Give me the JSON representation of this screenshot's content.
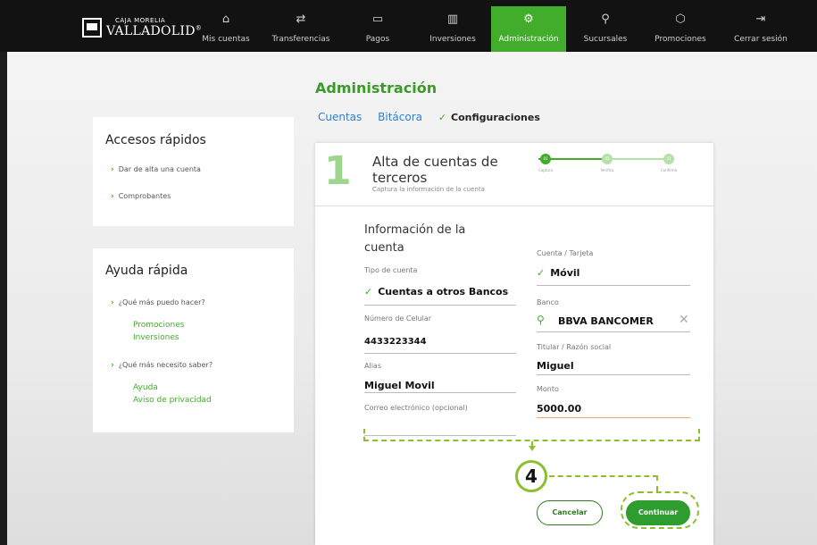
{
  "brand": {
    "line1": "CAJA MORELIA",
    "line2": "VALLADOLID",
    "mark": "®"
  },
  "nav": [
    {
      "label": "Mis cuentas",
      "icon": "home-icon",
      "glyph": "⌂"
    },
    {
      "label": "Transferencias",
      "icon": "transfer-icon",
      "glyph": "⇄"
    },
    {
      "label": "Pagos",
      "icon": "payments-icon",
      "glyph": "▭"
    },
    {
      "label": "Inversiones",
      "icon": "investments-icon",
      "glyph": "▥"
    },
    {
      "label": "Administración",
      "icon": "gear-icon",
      "glyph": "⚙"
    },
    {
      "label": "Sucursales",
      "icon": "location-icon",
      "glyph": "⚲"
    },
    {
      "label": "Promociones",
      "icon": "tag-icon",
      "glyph": "⬡"
    },
    {
      "label": "Cerrar sesión",
      "icon": "logout-icon",
      "glyph": "⇥"
    }
  ],
  "page": {
    "title": "Administración"
  },
  "breadcrumb": {
    "link1": "Cuentas",
    "link2": "Bitácora",
    "active": "Configuraciones"
  },
  "quick_access": {
    "title": "Accesos rápidos",
    "items": [
      "Dar de alta una cuenta",
      "Comprobantes"
    ]
  },
  "quick_help": {
    "title": "Ayuda rápida",
    "q1": "¿Qué más puedo hacer?",
    "q1_links": [
      "Promociones",
      "Inversiones"
    ],
    "q2": "¿Qué más necesito saber?",
    "q2_links": [
      "Ayuda",
      "Aviso de privacidad"
    ]
  },
  "form": {
    "step": "1",
    "title": "Alta de cuentas de terceros",
    "subtitle": "Captura la información de la cuenta",
    "stepper": [
      {
        "num": "01",
        "label": "Captura"
      },
      {
        "num": "02",
        "label": "Verifica"
      },
      {
        "num": "03",
        "label": "Confirma"
      }
    ],
    "section_title": "Información de la cuenta",
    "fields": {
      "tipo_label": "Tipo de cuenta",
      "tipo_value": "Cuentas a otros Bancos",
      "celular_label": "Número de Celular",
      "celular_value": "4433223344",
      "alias_label": "Alias",
      "alias_value": "Miguel Movil",
      "correo_label": "Correo electrónico (opcional)",
      "correo_value": "",
      "cuenta_label": "Cuenta / Tarjeta",
      "cuenta_value": "Móvil",
      "banco_label": "Banco",
      "banco_value": "BBVA BANCOMER",
      "titular_label": "Titular / Razón social",
      "titular_value": "Miguel",
      "monto_label": "Monto",
      "monto_value": "5000.00"
    },
    "cancel_label": "Cancelar",
    "continue_label": "Continuar"
  },
  "annotation": {
    "number": "4"
  },
  "colors": {
    "accent": "#41ad2b",
    "link": "#2f7fd3",
    "annotation": "#8cbf2d",
    "topbar": "#121212"
  }
}
